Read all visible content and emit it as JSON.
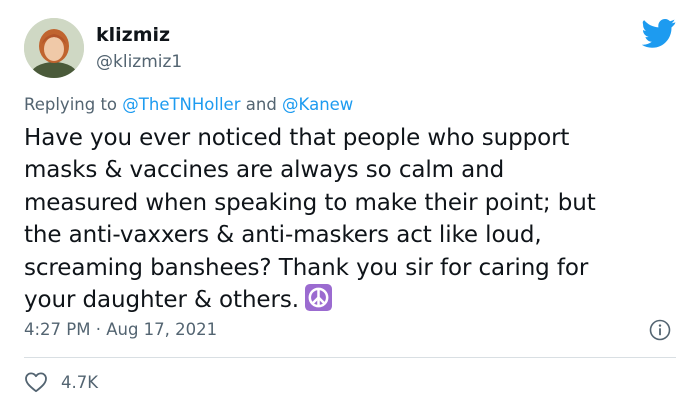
{
  "author": {
    "display_name": "klizmiz",
    "handle": "@klizmiz1"
  },
  "reply": {
    "prefix": "Replying to",
    "mention_1": "@TheTNHoller",
    "conjunction": "and",
    "mention_2": "@Kanew"
  },
  "tweet": {
    "lines": [
      "Have you ever noticed that people who support",
      "masks & vaccines are always so calm and",
      "measured when speaking to make their point; but",
      "the anti-vaxxers & anti-maskers act like loud,",
      "screaming banshees? Thank you sir for caring for",
      "your daughter & others."
    ],
    "emoji": "peace-symbol-emoji"
  },
  "meta": {
    "timestamp": "4:27 PM · Aug 17, 2021"
  },
  "actions": {
    "like_count": "4.7K"
  },
  "icons": {
    "logo": "twitter-bird-icon",
    "info": "info-icon",
    "like": "heart-icon"
  },
  "colors": {
    "brand": "#1d9bf0",
    "text": "#0f1419",
    "secondary": "#536471",
    "emoji_bg": "#9b6bd0"
  }
}
